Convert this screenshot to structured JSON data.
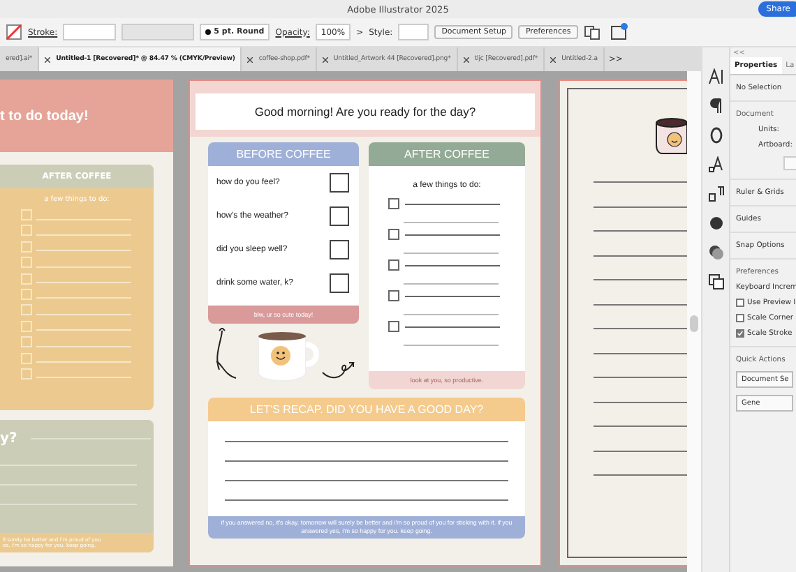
{
  "window": {
    "title": "Adobe Illustrator 2025",
    "share_button": "Share"
  },
  "control_bar": {
    "stroke_label": "Stroke:",
    "brush": "5 pt. Round",
    "opacity_label": "Opacity:",
    "opacity": "100%",
    "opacity_more": ">",
    "style_label": "Style:",
    "buttons": [
      "Document Setup",
      "Preferences"
    ]
  },
  "document_tabs": [
    {
      "label": "ered].ai*",
      "selected": false,
      "closable": false
    },
    {
      "label": "Untitled-1 [Recovered]* @ 84.47 % (CMYK/Preview)",
      "selected": true,
      "closable": true
    },
    {
      "label": "coffee-shop.pdf*",
      "selected": false,
      "closable": true
    },
    {
      "label": "Untitled_Artwork 44 [Recovered].png*",
      "selected": false,
      "closable": true
    },
    {
      "label": "tljc [Recovered].pdf*",
      "selected": false,
      "closable": true
    },
    {
      "label": "Untitled-2.a",
      "selected": false,
      "closable": true
    }
  ],
  "tab_overflow": ">>",
  "left_artboard": {
    "title": "t to do today!",
    "card_title": "AFTER COFFEE",
    "card_subtitle": "a few things to do:",
    "todos": [
      {
        "checked": false
      },
      {
        "checked": false
      },
      {
        "checked": false
      },
      {
        "checked": false
      },
      {
        "checked": false
      },
      {
        "checked": false
      },
      {
        "checked": false
      },
      {
        "checked": false
      },
      {
        "checked": false
      },
      {
        "checked": false
      },
      {
        "checked": false
      }
    ],
    "recap_title": "y?",
    "recap_note_lines": [
      "ll surely be better and i'm proud of you",
      "es, i'm so happy for you. keep going."
    ]
  },
  "center_artboard": {
    "greeting": "Good morning! Are you ready for the day?",
    "before_coffee": {
      "title": "BEFORE COFFEE",
      "questions": [
        "how do you feel?",
        "how's the weather?",
        "did you sleep well?",
        "drink some water, k?"
      ],
      "footer": "blw, ur so cute today!"
    },
    "after_coffee": {
      "title": "AFTER COFFEE",
      "subtitle": "a few things to do:",
      "todos": [
        {
          "checked": false
        },
        {
          "checked": false
        },
        {
          "checked": false
        },
        {
          "checked": false
        },
        {
          "checked": false
        }
      ],
      "footer": "look at you, so productive."
    },
    "recap": {
      "title": "LET'S RECAP. DID YOU HAVE A GOOD DAY?",
      "footer": "if you answered no, it's okay. tomorrow will surely be better and i'm so proud of you for sticking with it. if you answered yes, i'm so happy for you. keep going."
    }
  },
  "properties_panel": {
    "collapse": "<<",
    "tabs": [
      {
        "label": "Properties",
        "selected": true
      },
      {
        "label": "La",
        "selected": false
      }
    ],
    "selection": "No Selection",
    "document_heading": "Document",
    "units_label": "Units:",
    "artboard_label": "Artboard:",
    "sections": [
      "Ruler & Grids",
      "Guides",
      "Snap Options"
    ],
    "preferences_heading": "Preferences",
    "keyboard_label": "Keyboard Increm",
    "options": [
      {
        "label": "Use Preview I",
        "checked": false
      },
      {
        "label": "Scale Corner",
        "checked": false
      },
      {
        "label": "Scale Stroke",
        "checked": true
      }
    ],
    "quick_actions_heading": "Quick Actions",
    "buttons": [
      "Document Se",
      "Gene"
    ]
  }
}
